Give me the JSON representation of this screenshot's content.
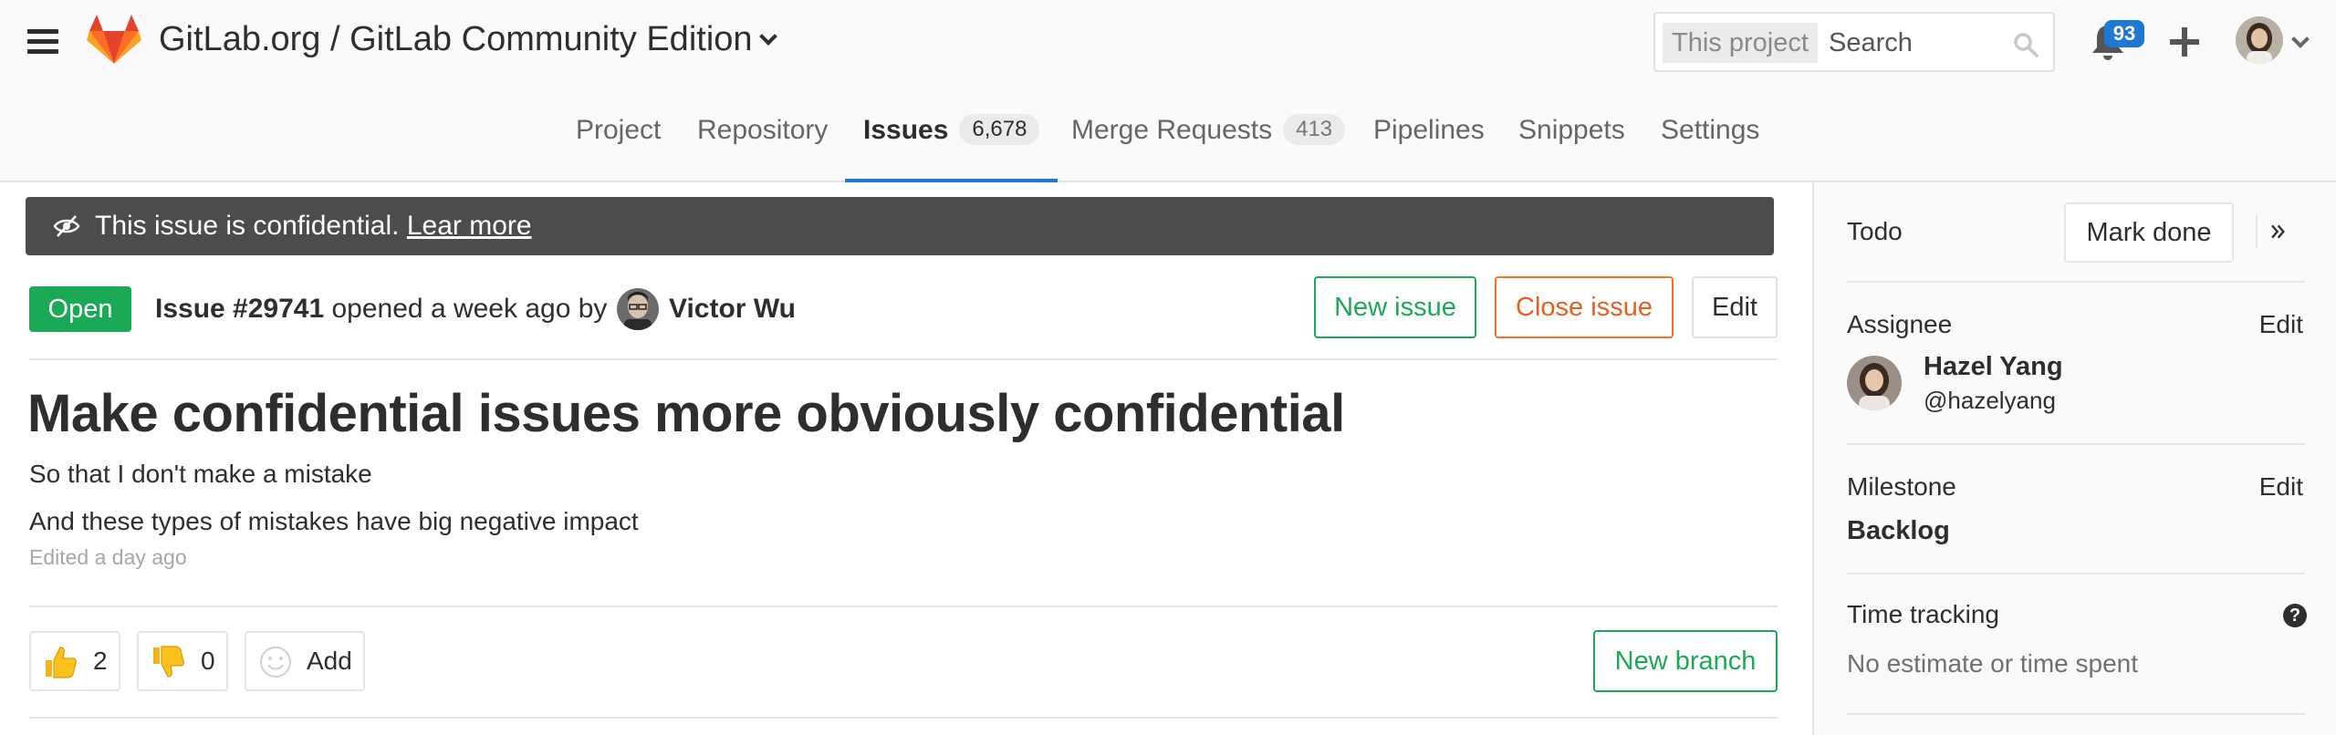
{
  "header": {
    "project_path": "GitLab.org / GitLab Community Edition",
    "search": {
      "scope": "This project",
      "placeholder": "Search"
    },
    "notifications_count": "93",
    "colors": {
      "accent": "#1f78d1",
      "logo_orange": "#e24329",
      "logo_light": "#fc6d26",
      "logo_yellow": "#fca326"
    }
  },
  "nav": {
    "items": [
      {
        "label": "Project"
      },
      {
        "label": "Repository"
      },
      {
        "label": "Issues",
        "count": "6,678",
        "active": true
      },
      {
        "label": "Merge Requests",
        "count": "413"
      },
      {
        "label": "Pipelines"
      },
      {
        "label": "Snippets"
      },
      {
        "label": "Settings"
      }
    ]
  },
  "banner": {
    "text": "This issue is confidential.",
    "link": "Lear more",
    "icon": "eye-slash-icon"
  },
  "issue": {
    "status": "Open",
    "status_color": "#1aaa55",
    "number": "Issue #29741",
    "opened_text": "opened a week ago by",
    "author": "Victor Wu",
    "title": "Make confidential issues more obviously confidential",
    "description": [
      "So that I don't make a mistake",
      "And these types of mistakes have big negative impact"
    ],
    "edited": "Edited a day ago",
    "buttons": {
      "new_issue": "New issue",
      "close_issue": "Close issue",
      "edit": "Edit",
      "new_branch": "New branch"
    },
    "awards": [
      {
        "emoji": "thumbsup-icon",
        "count": "2"
      },
      {
        "emoji": "thumbsdown-icon",
        "count": "0"
      }
    ],
    "add_award_label": "Add"
  },
  "sidebar": {
    "todo_label": "Todo",
    "mark_done": "Mark done",
    "assignee": {
      "label": "Assignee",
      "edit": "Edit",
      "name": "Hazel Yang",
      "handle": "@hazelyang"
    },
    "milestone": {
      "label": "Milestone",
      "edit": "Edit",
      "value": "Backlog"
    },
    "time_tracking": {
      "label": "Time tracking",
      "text": "No estimate or time spent"
    }
  }
}
